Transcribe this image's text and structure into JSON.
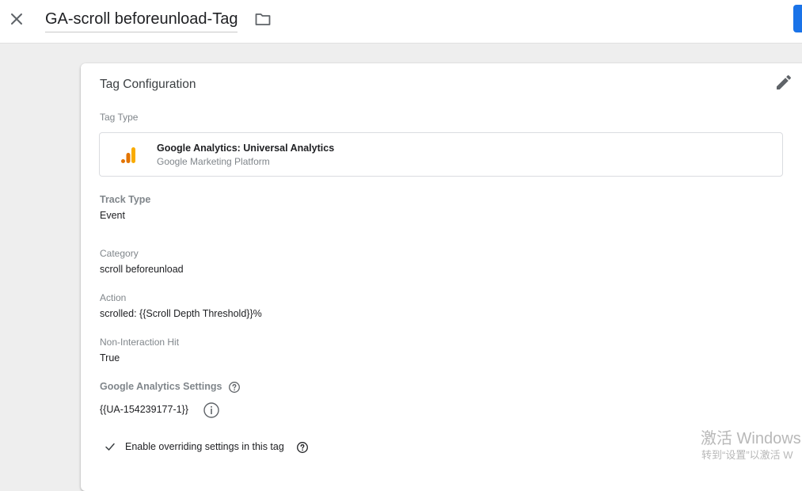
{
  "header": {
    "tag_name": "GA-scroll beforeunload-Tag",
    "close_icon": "close-icon",
    "folder_icon": "folder-icon"
  },
  "card": {
    "title": "Tag Configuration",
    "edit_icon": "pencil-icon",
    "tag_type_label": "Tag Type",
    "tag_type": {
      "name": "Google Analytics: Universal Analytics",
      "provider": "Google Marketing Platform",
      "icon": "google-analytics-icon"
    },
    "track_type_label": "Track Type",
    "track_type_value": "Event",
    "category_label": "Category",
    "category_value": "scroll beforeunload",
    "action_label": "Action",
    "action_value": "scrolled: {{Scroll Depth Threshold}}%",
    "non_interaction_label": "Non-Interaction Hit",
    "non_interaction_value": "True",
    "ga_settings_label": "Google Analytics Settings",
    "ga_settings_value": "{{UA-154239177-1}}",
    "override_label": "Enable overriding settings in this tag"
  },
  "watermark": {
    "line1": "激活 Windows",
    "line2": "转到“设置”以激活 W"
  },
  "colors": {
    "accent": "#1a73e8",
    "ga_orange": "#f9ab00",
    "ga_dark_orange": "#e37400"
  }
}
